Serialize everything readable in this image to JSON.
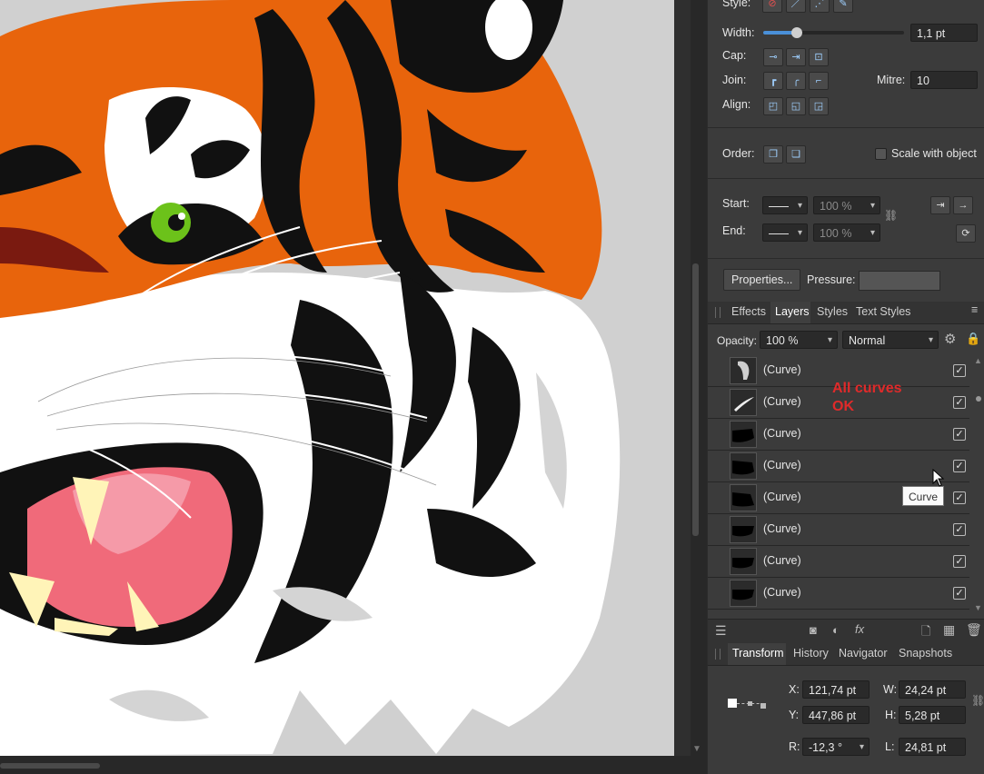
{
  "stroke": {
    "style_label": "Style:",
    "width_label": "Width:",
    "width_value": "1,1 pt",
    "width_fraction": 0.24,
    "cap_label": "Cap:",
    "join_label": "Join:",
    "mitre_label": "Mitre:",
    "mitre_value": "10",
    "align_label": "Align:",
    "order_label": "Order:",
    "scale_with_object_label": "Scale with object",
    "start_label": "Start:",
    "end_label": "End:",
    "start_percent": "100 %",
    "end_percent": "100 %",
    "properties_button": "Properties...",
    "pressure_label": "Pressure:"
  },
  "layers_panel": {
    "tabs": [
      {
        "label": "Effects",
        "active": false
      },
      {
        "label": "Layers",
        "active": true
      },
      {
        "label": "Styles",
        "active": false
      },
      {
        "label": "Text Styles",
        "active": false
      }
    ],
    "opacity_label": "Opacity:",
    "opacity_value": "100 %",
    "blend_mode": "Normal",
    "layers": [
      {
        "name": "(Curve)",
        "visible": true
      },
      {
        "name": "(Curve)",
        "visible": true
      },
      {
        "name": "(Curve)",
        "visible": true
      },
      {
        "name": "(Curve)",
        "visible": true
      },
      {
        "name": "(Curve)",
        "visible": true
      },
      {
        "name": "(Curve)",
        "visible": true
      },
      {
        "name": "(Curve)",
        "visible": true
      },
      {
        "name": "(Curve)",
        "visible": true
      }
    ],
    "tooltip": "Curve"
  },
  "annotation": {
    "line1": "All curves",
    "line2": "OK",
    "color": "#e02a2a"
  },
  "transform_panel": {
    "tabs": [
      {
        "label": "Transform",
        "active": true
      },
      {
        "label": "History",
        "active": false
      },
      {
        "label": "Navigator",
        "active": false
      },
      {
        "label": "Snapshots",
        "active": false
      }
    ],
    "x_label": "X:",
    "x_value": "121,74 pt",
    "y_label": "Y:",
    "y_value": "447,86 pt",
    "w_label": "W:",
    "w_value": "24,24 pt",
    "h_label": "H:",
    "h_value": "5,28 pt",
    "r_label": "R:",
    "r_value": "-12,3 °",
    "l_label": "L:",
    "l_value": "24,81 pt"
  },
  "colors": {
    "panel_bg": "#3b3b3b",
    "accent": "#4a90d9",
    "tiger_orange": "#e8640c",
    "eye_green": "#6cc21a",
    "mouth_pink": "#f06a7a"
  }
}
